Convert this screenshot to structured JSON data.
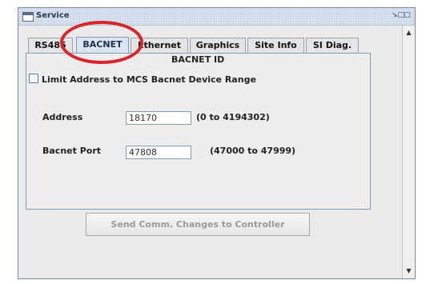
{
  "window": {
    "title": "Service",
    "restore_icon": "restore-icon",
    "maximize_icon": "maximize-icon"
  },
  "tabs": [
    {
      "label": "RS485",
      "selected": false
    },
    {
      "label": "BACNET",
      "selected": true
    },
    {
      "label": "Ethernet",
      "selected": false
    },
    {
      "label": "Graphics",
      "selected": false
    },
    {
      "label": "Site Info",
      "selected": false
    },
    {
      "label": "SI Diag.",
      "selected": false
    }
  ],
  "bacnet": {
    "section_title": "BACNET ID",
    "limit_checkbox_label": "Limit Address to MCS Bacnet Device Range",
    "limit_checked": false,
    "address_label": "Address",
    "address_value": "18170",
    "address_range": "(0 to 4194302)",
    "port_label": "Bacnet Port",
    "port_value": "47808",
    "port_range": "(47000 to 47999)"
  },
  "send_button_label": "Send Comm. Changes to Controller",
  "colors": {
    "highlight": "#d6262b",
    "tab_selected": "#dbe5f1"
  }
}
